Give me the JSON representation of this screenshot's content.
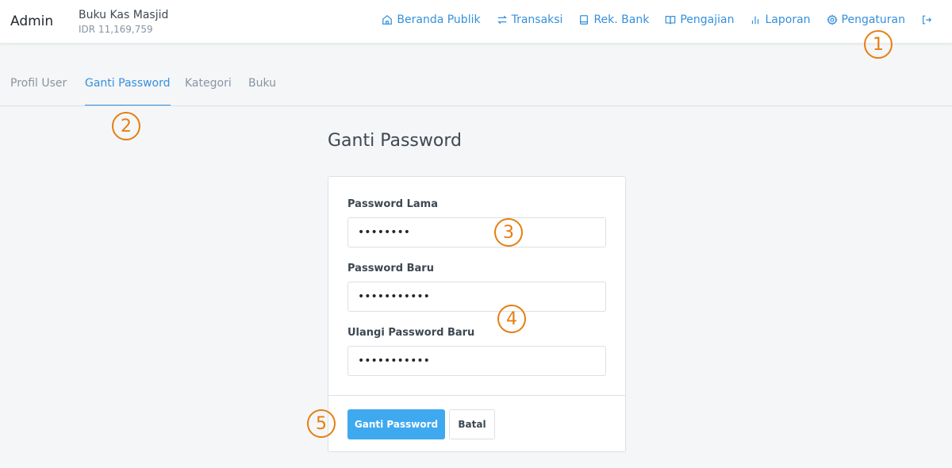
{
  "navbar": {
    "brand": "Admin",
    "org_name": "Buku Kas Masjid",
    "org_balance": "IDR 11,169,759",
    "links": [
      {
        "label": "Beranda Publik",
        "icon": "home-icon"
      },
      {
        "label": "Transaksi",
        "icon": "refresh-icon"
      },
      {
        "label": "Rek. Bank",
        "icon": "book-icon"
      },
      {
        "label": "Pengajian",
        "icon": "open-book-icon"
      },
      {
        "label": "Laporan",
        "icon": "bar-chart-icon"
      },
      {
        "label": "Pengaturan",
        "icon": "gear-icon"
      }
    ],
    "logout_icon": "logout-icon"
  },
  "tabs": [
    {
      "label": "Profil User",
      "active": false
    },
    {
      "label": "Ganti Password",
      "active": true
    },
    {
      "label": "Kategori",
      "active": false
    },
    {
      "label": "Buku",
      "active": false
    }
  ],
  "page": {
    "title": "Ganti Password"
  },
  "form": {
    "old_password": {
      "label": "Password Lama",
      "value": "12345678"
    },
    "new_password": {
      "label": "Password Baru",
      "value": "12345678901"
    },
    "confirm_password": {
      "label": "Ulangi Password Baru",
      "value": "12345678901"
    },
    "submit_label": "Ganti Password",
    "cancel_label": "Batal"
  },
  "markers": [
    "1",
    "2",
    "3",
    "4",
    "5"
  ],
  "colors": {
    "accent": "#3490dc",
    "primary_button": "#3fa9f0",
    "marker": "#e67e0f"
  }
}
